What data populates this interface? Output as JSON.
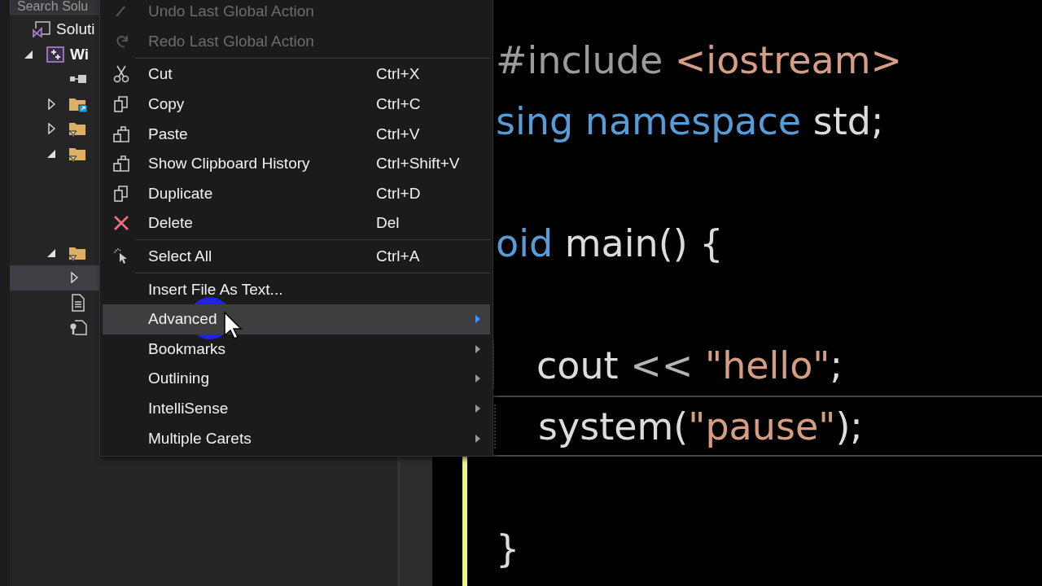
{
  "solution_explorer": {
    "search": {
      "placeholder": "Search Solu"
    },
    "tree": [
      {
        "label": "Soluti",
        "kind": "solution",
        "selected": false,
        "children": [
          {
            "label": "Wi",
            "kind": "project",
            "expanded": true,
            "selected": false,
            "children": [
              {
                "kind": "references",
                "selected": false
              },
              {
                "kind": "folder-link",
                "expanded": false,
                "selected": false
              },
              {
                "kind": "filter-folder",
                "expanded": false,
                "selected": false
              },
              {
                "kind": "filter-folder",
                "expanded": true,
                "selected": false
              },
              {
                "kind": "filter-folder",
                "expanded": true,
                "selected": false,
                "children": [
                  {
                    "expanded": false,
                    "selected": true
                  }
                ]
              },
              {
                "kind": "file",
                "selected": false
              },
              {
                "kind": "settings-file",
                "selected": false
              }
            ]
          }
        ]
      }
    ]
  },
  "context_menu": [
    {
      "kind": "command",
      "label": "Undo Last Global Action",
      "disabled": true,
      "selected": false
    },
    {
      "kind": "command",
      "label": "Redo Last Global Action",
      "disabled": true,
      "selected": false
    },
    {
      "kind": "separator"
    },
    {
      "kind": "command",
      "label": "Cut",
      "shortcut": "Ctrl+X",
      "disabled": false,
      "selected": false
    },
    {
      "kind": "command",
      "label": "Copy",
      "shortcut": "Ctrl+C",
      "disabled": false,
      "selected": false
    },
    {
      "kind": "command",
      "label": "Paste",
      "shortcut": "Ctrl+V",
      "disabled": false,
      "selected": false
    },
    {
      "kind": "command",
      "label": "Show Clipboard History",
      "shortcut": "Ctrl+Shift+V",
      "disabled": false,
      "selected": false
    },
    {
      "kind": "command",
      "label": "Duplicate",
      "shortcut": "Ctrl+D",
      "disabled": false,
      "selected": false
    },
    {
      "kind": "command",
      "label": "Delete",
      "shortcut": "Del",
      "disabled": false,
      "selected": false
    },
    {
      "kind": "separator"
    },
    {
      "kind": "command",
      "label": "Select All",
      "shortcut": "Ctrl+A",
      "disabled": false,
      "selected": false
    },
    {
      "kind": "separator"
    },
    {
      "kind": "command",
      "label": "Insert File As Text...",
      "disabled": false,
      "selected": false
    },
    {
      "kind": "submenu",
      "label": "Advanced",
      "disabled": false,
      "selected": true
    },
    {
      "kind": "submenu",
      "label": "Bookmarks",
      "disabled": false,
      "selected": false
    },
    {
      "kind": "submenu",
      "label": "Outlining",
      "disabled": false,
      "selected": false
    },
    {
      "kind": "submenu",
      "label": "IntelliSense",
      "disabled": false,
      "selected": false
    },
    {
      "kind": "submenu",
      "label": "Multiple Carets",
      "disabled": false,
      "selected": false
    }
  ],
  "editor": {
    "lines": [
      {
        "kind": "code",
        "indented": false,
        "current": false,
        "tokens": [
          {
            "text": "#include ",
            "kind": "preprocessor"
          },
          {
            "text": "<iostream>",
            "kind": "string"
          }
        ]
      },
      {
        "kind": "code",
        "indented": false,
        "current": false,
        "tokens": [
          {
            "text": "sing namespace ",
            "kind": "keyword"
          },
          {
            "text": "std;",
            "kind": "plain"
          }
        ]
      },
      {
        "kind": "blank"
      },
      {
        "kind": "code",
        "indented": false,
        "current": false,
        "tokens": [
          {
            "text": "oid ",
            "kind": "keyword"
          },
          {
            "text": "main() {",
            "kind": "plain"
          }
        ]
      },
      {
        "kind": "blank"
      },
      {
        "kind": "code",
        "indented": true,
        "current": false,
        "tokens": [
          {
            "text": "cout ",
            "kind": "plain"
          },
          {
            "text": "<< ",
            "kind": "operator"
          },
          {
            "text": "\"hello\"",
            "kind": "string"
          },
          {
            "text": ";",
            "kind": "plain"
          }
        ]
      },
      {
        "kind": "code",
        "indented": true,
        "current": true,
        "tokens": [
          {
            "text": "system(",
            "kind": "plain"
          },
          {
            "text": "\"pause\"",
            "kind": "string"
          },
          {
            "text": ");",
            "kind": "plain"
          }
        ]
      },
      {
        "kind": "blank"
      },
      {
        "kind": "code",
        "indented": false,
        "current": false,
        "tokens": [
          {
            "text": "}",
            "kind": "plain"
          }
        ]
      }
    ]
  }
}
